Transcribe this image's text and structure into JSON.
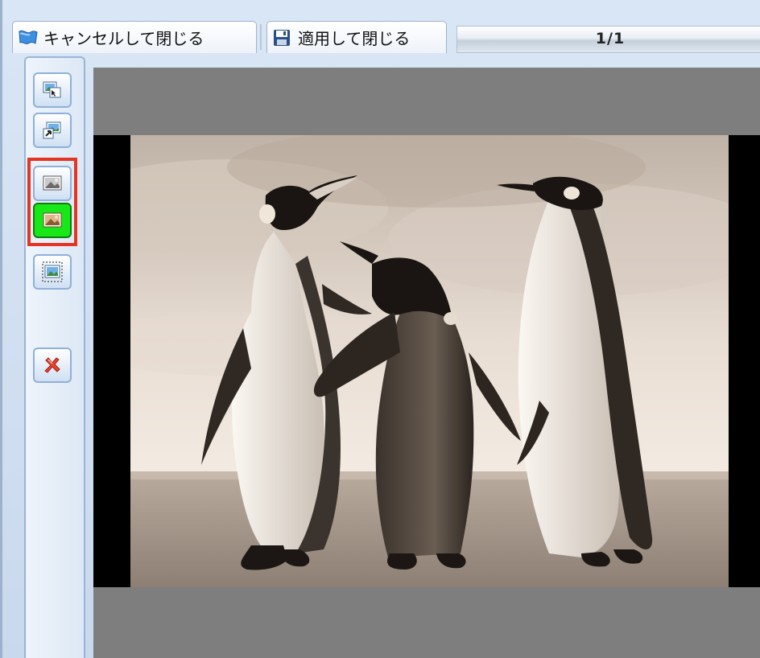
{
  "toolbar": {
    "cancel_label": "キャンセルして閉じる",
    "apply_label": "適用して閉じる",
    "page_indicator": "1/1"
  },
  "side_tools": [
    {
      "name": "import-image-icon",
      "selected": false
    },
    {
      "name": "export-image-icon",
      "selected": false
    },
    {
      "name": "grayscale-image-icon",
      "selected": true
    },
    {
      "name": "sepia-image-icon",
      "selected": true,
      "highlight": "#18e818"
    },
    {
      "name": "fit-image-icon",
      "selected": false
    },
    {
      "name": "delete-icon",
      "selected": false
    }
  ],
  "viewer": {
    "image_subject": "three king penguins on a beach in sepia tone",
    "background": "#7e7e7e"
  },
  "colors": {
    "selection_outline": "#e53522",
    "active_tool": "#18e818"
  }
}
